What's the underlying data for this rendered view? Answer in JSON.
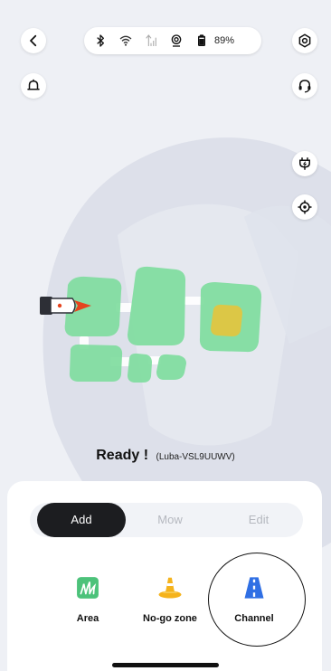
{
  "header": {
    "back_icon": "chevron-left-icon",
    "settings_icon": "hexagon-gear-icon",
    "notification_icon": "bell-icon",
    "support_icon": "headset-icon"
  },
  "status_bar": {
    "bluetooth_icon": "bluetooth-icon",
    "wifi_icon": "wifi-icon",
    "cellular_icon": "cellular-signal-icon",
    "rtk_icon": "rtk-antenna-icon",
    "battery_icon": "battery-icon",
    "battery_percent": "89%"
  },
  "map_controls": {
    "charging_station_icon": "charging-station-icon",
    "locate_icon": "crosshair-icon"
  },
  "status": {
    "ready_text": "Ready !",
    "device_name": "(Luba-VSL9UUWV)"
  },
  "tabs": [
    {
      "label": "Add",
      "active": true
    },
    {
      "label": "Mow",
      "active": false
    },
    {
      "label": "Edit",
      "active": false
    }
  ],
  "tools": [
    {
      "label": "Area",
      "icon": "area-grass-icon",
      "color": "#4cc27a"
    },
    {
      "label": "No-go zone",
      "icon": "traffic-cone-icon",
      "color": "#f5b31c"
    },
    {
      "label": "Channel",
      "icon": "road-channel-icon",
      "color": "#2f6fe4",
      "selected": true
    }
  ],
  "colors": {
    "zone": "#7fdc9e",
    "no_go": "#e6c43c",
    "mower_arrow": "#e5441e"
  }
}
